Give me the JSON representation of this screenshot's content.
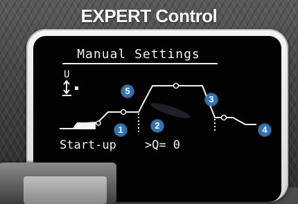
{
  "header": {
    "title": "EXPERT Control"
  },
  "display": {
    "heading": "Manual Settings",
    "axis_label": "U",
    "status_left": "Start-up",
    "status_right": ">Q= 0"
  },
  "markers": [
    "1",
    "2",
    "3",
    "4",
    "5"
  ],
  "colors": {
    "screen": "#020202",
    "text": "#f2f2f2",
    "badge": "#2f73b8"
  },
  "icons": [
    "up-down-arrow-icon"
  ]
}
